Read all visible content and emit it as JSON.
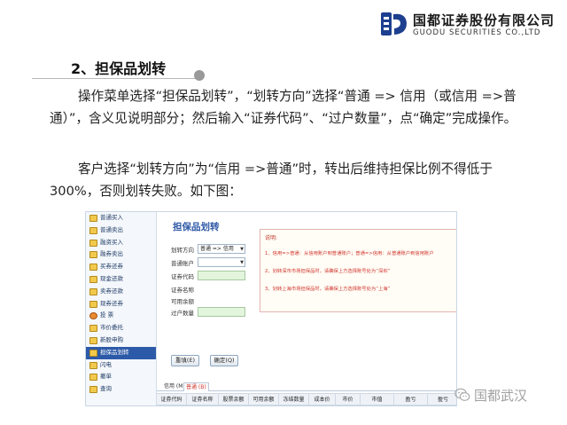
{
  "brand": {
    "name_cn": "国都证券股份有限公司",
    "name_en": "GUODU SECURITIES CO.,LTD",
    "color": "#1d3f8f"
  },
  "section": {
    "title": "2、担保品划转"
  },
  "paragraphs": [
    "操作菜单选择“担保品划转”，“划转方向”选择“普通 => 信用（或信用 =>普通）”，含义见说明部分；然后输入“证券代码”、“过户数量”，点“确定”完成操作。",
    "客户选择“划转方向”为“信用 =>普通”时，转出后维持担保比例不得低于300%，否则划转失败。如下图："
  ],
  "app": {
    "menu": [
      "普通买入",
      "普通卖出",
      "融资买入",
      "融券卖出",
      "买券还券",
      "现金还款",
      "卖券还款",
      "现券还券",
      "投 票",
      "市价委托",
      "新股申购",
      "担保品划转",
      "闪电",
      "撤单",
      "查询"
    ],
    "active_menu_index": 11,
    "title": "担保品划转",
    "form": {
      "direction_label": "划转方向",
      "direction_value": "普通 => 信用",
      "account_label": "普通账户",
      "account_value": "",
      "code_label": "证券代码",
      "name_label": "证券名称",
      "available_label": "可用余额",
      "qty_label": "过户数量"
    },
    "note": {
      "title": "说明:",
      "lines": [
        "1、信用=>普通：从信用账户到普通账户；普通=>信用：从普通账户到信用账户",
        "2、划转深市市场担保品时，请确保上方选择账号处为“深圳”",
        "3、划转上海市场担保品时，请确保上方选择账号处为“上海”"
      ]
    },
    "buttons": {
      "reset": "重填(E)",
      "confirm": "确定(Q)"
    },
    "tabs": [
      "信用 (M)",
      "普通 (B)"
    ],
    "grid_headers": [
      "证券代码",
      "证券名称",
      "股票余额",
      "可用余额",
      "冻结数量",
      "成本价",
      "市价",
      "市值",
      "盈亏",
      "盈亏"
    ]
  },
  "watermark": {
    "text": "国都武汉"
  }
}
